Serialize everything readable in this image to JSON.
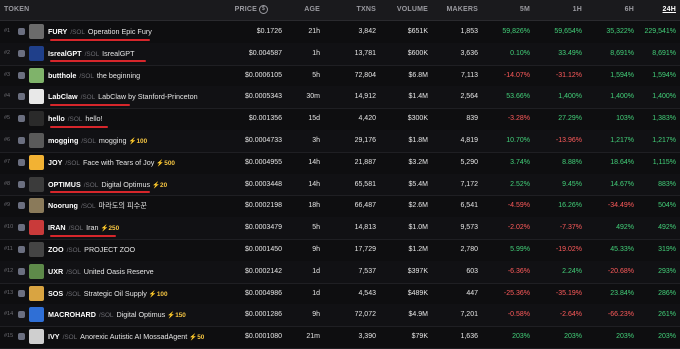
{
  "headers": {
    "token": "TOKEN",
    "price": "PRICE",
    "price_icon": "$",
    "age": "AGE",
    "txns": "TXNS",
    "volume": "VOLUME",
    "makers": "MAKERS",
    "m5": "5M",
    "h1": "1H",
    "h6": "6H",
    "h24": "24H"
  },
  "sol_label": "/SOL",
  "rows": [
    {
      "rank": "#1",
      "symbol": "FURY",
      "name": "Operation Epic Fury",
      "boost": "",
      "price": "$0.1726",
      "age": "21h",
      "txns": "3,842",
      "volume": "$651K",
      "makers": "1,853",
      "m5": "59,826%",
      "h1": "59,654%",
      "h6": "35,322%",
      "h24": "229,541%",
      "m5c": "pos",
      "h1c": "pos",
      "h6c": "pos",
      "h24c": "pos",
      "thumb": "#6b6b6b"
    },
    {
      "rank": "#2",
      "symbol": "IsrealGPT",
      "name": "IsrealGPT",
      "boost": "",
      "price": "$0.004587",
      "age": "1h",
      "txns": "13,781",
      "volume": "$600K",
      "makers": "3,636",
      "m5": "0.10%",
      "h1": "33.49%",
      "h6": "8,691%",
      "h24": "8,691%",
      "m5c": "pos",
      "h1c": "pos",
      "h6c": "pos",
      "h24c": "pos",
      "thumb": "#1f3f8a"
    },
    {
      "rank": "#3",
      "symbol": "butthole",
      "name": "the beginning",
      "boost": "",
      "price": "$0.0006105",
      "age": "5h",
      "txns": "72,804",
      "volume": "$6.8M",
      "makers": "7,113",
      "m5": "-14.07%",
      "h1": "-31.12%",
      "h6": "1,594%",
      "h24": "1,594%",
      "m5c": "neg",
      "h1c": "neg",
      "h6c": "pos",
      "h24c": "pos",
      "thumb": "#7fb36a"
    },
    {
      "rank": "#4",
      "symbol": "LabClaw",
      "name": "LabClaw by Stanford-Princeton",
      "boost": "",
      "price": "$0.0005343",
      "age": "30m",
      "txns": "14,912",
      "volume": "$1.4M",
      "makers": "2,564",
      "m5": "53.66%",
      "h1": "1,400%",
      "h6": "1,400%",
      "h24": "1,400%",
      "m5c": "pos",
      "h1c": "pos",
      "h6c": "pos",
      "h24c": "pos",
      "thumb": "#e8e8e8"
    },
    {
      "rank": "#5",
      "symbol": "hello",
      "name": "hello!",
      "boost": "",
      "price": "$0.001356",
      "age": "15d",
      "txns": "4,420",
      "volume": "$300K",
      "makers": "839",
      "m5": "-3.28%",
      "h1": "27.29%",
      "h6": "103%",
      "h24": "1,383%",
      "m5c": "neg",
      "h1c": "pos",
      "h6c": "pos",
      "h24c": "pos",
      "thumb": "#2a2a2a"
    },
    {
      "rank": "#6",
      "symbol": "mogging",
      "name": "mogging",
      "boost": "⚡100",
      "price": "$0.0004733",
      "age": "3h",
      "txns": "29,176",
      "volume": "$1.8M",
      "makers": "4,819",
      "m5": "10.70%",
      "h1": "-13.96%",
      "h6": "1,217%",
      "h24": "1,217%",
      "m5c": "pos",
      "h1c": "neg",
      "h6c": "pos",
      "h24c": "pos",
      "thumb": "#5a5a5a"
    },
    {
      "rank": "#7",
      "symbol": "JOY",
      "name": "Face with Tears of Joy",
      "boost": "⚡500",
      "price": "$0.0004955",
      "age": "14h",
      "txns": "21,887",
      "volume": "$3.2M",
      "makers": "5,290",
      "m5": "3.74%",
      "h1": "8.88%",
      "h6": "18.64%",
      "h24": "1,115%",
      "m5c": "pos",
      "h1c": "pos",
      "h6c": "pos",
      "h24c": "pos",
      "thumb": "#f2b233"
    },
    {
      "rank": "#8",
      "symbol": "OPTIMUS",
      "name": "Digital Optimus",
      "boost": "⚡20",
      "price": "$0.0003448",
      "age": "14h",
      "txns": "65,581",
      "volume": "$5.4M",
      "makers": "7,172",
      "m5": "2.52%",
      "h1": "9.45%",
      "h6": "14.67%",
      "h24": "883%",
      "m5c": "pos",
      "h1c": "pos",
      "h6c": "pos",
      "h24c": "pos",
      "thumb": "#3b3b3b"
    },
    {
      "rank": "#9",
      "symbol": "Noorung",
      "name": "마라도의 피수꾼",
      "boost": "",
      "price": "$0.0002198",
      "age": "18h",
      "txns": "66,487",
      "volume": "$2.6M",
      "makers": "6,541",
      "m5": "-4.59%",
      "h1": "16.26%",
      "h6": "-34.49%",
      "h24": "504%",
      "m5c": "neg",
      "h1c": "pos",
      "h6c": "neg",
      "h24c": "pos",
      "thumb": "#8a7a5a"
    },
    {
      "rank": "#10",
      "symbol": "IRAN",
      "name": "Iran",
      "boost": "⚡250",
      "price": "$0.0003479",
      "age": "5h",
      "txns": "14,813",
      "volume": "$1.0M",
      "makers": "9,573",
      "m5": "-2.02%",
      "h1": "-7.37%",
      "h6": "492%",
      "h24": "492%",
      "m5c": "neg",
      "h1c": "neg",
      "h6c": "pos",
      "h24c": "pos",
      "thumb": "#c93a3a"
    },
    {
      "rank": "#11",
      "symbol": "ZOO",
      "name": "PROJECT ZOO",
      "boost": "",
      "price": "$0.0001450",
      "age": "9h",
      "txns": "17,729",
      "volume": "$1.2M",
      "makers": "2,780",
      "m5": "5.99%",
      "h1": "-19.02%",
      "h6": "45.33%",
      "h24": "319%",
      "m5c": "pos",
      "h1c": "neg",
      "h6c": "pos",
      "h24c": "pos",
      "thumb": "#444444"
    },
    {
      "rank": "#12",
      "symbol": "UXR",
      "name": "United Oasis Reserve",
      "boost": "",
      "price": "$0.0002142",
      "age": "1d",
      "txns": "7,537",
      "volume": "$397K",
      "makers": "603",
      "m5": "-6.36%",
      "h1": "2.24%",
      "h6": "-20.68%",
      "h24": "293%",
      "m5c": "neg",
      "h1c": "pos",
      "h6c": "neg",
      "h24c": "pos",
      "thumb": "#5e8a4a"
    },
    {
      "rank": "#13",
      "symbol": "SOS",
      "name": "Strategic Oil Supply",
      "boost": "⚡100",
      "price": "$0.0004986",
      "age": "1d",
      "txns": "4,543",
      "volume": "$489K",
      "makers": "447",
      "m5": "-25.36%",
      "h1": "-35.19%",
      "h6": "23.84%",
      "h24": "286%",
      "m5c": "neg",
      "h1c": "neg",
      "h6c": "pos",
      "h24c": "pos",
      "thumb": "#d9a441"
    },
    {
      "rank": "#14",
      "symbol": "MACROHARD",
      "name": "Digital Optimus",
      "boost": "⚡150",
      "price": "$0.0001286",
      "age": "9h",
      "txns": "72,072",
      "volume": "$4.9M",
      "makers": "7,201",
      "m5": "-0.58%",
      "h1": "-2.64%",
      "h6": "-66.23%",
      "h24": "261%",
      "m5c": "neg",
      "h1c": "neg",
      "h6c": "neg",
      "h24c": "pos",
      "thumb": "#2f6fd6"
    },
    {
      "rank": "#15",
      "symbol": "IVY",
      "name": "Anorexic Autistic AI MossadAgent",
      "boost": "⚡50",
      "price": "$0.0001080",
      "age": "21m",
      "txns": "3,390",
      "volume": "$79K",
      "makers": "1,636",
      "m5": "203%",
      "h1": "203%",
      "h6": "203%",
      "h24": "203%",
      "m5c": "pos",
      "h1c": "pos",
      "h6c": "pos",
      "h24c": "pos",
      "thumb": "#cfcfcf"
    }
  ]
}
